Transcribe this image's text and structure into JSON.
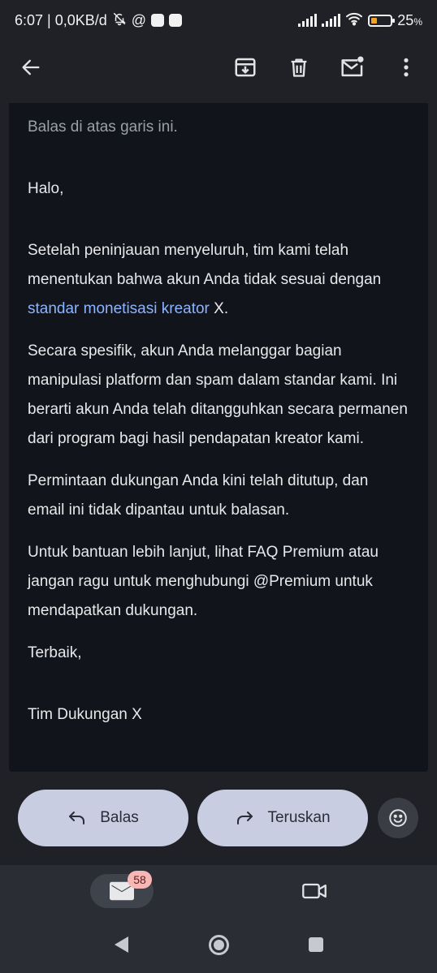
{
  "status_bar": {
    "time_speed": "6:07 | 0,0KB/d",
    "at_symbol": "@",
    "battery_percent": "25",
    "battery_unit": "%"
  },
  "app_bar": {
    "icons": [
      "back-arrow-icon",
      "archive-icon",
      "trash-icon",
      "mark-unread-icon",
      "more-vert-icon"
    ]
  },
  "email": {
    "quote_line": "Balas di atas garis ini.",
    "greeting": "Halo,",
    "p1_before": "Setelah peninjauan menyeluruh, tim kami telah menentukan bahwa akun Anda tidak sesuai dengan ",
    "p1_link": "standar monetisasi kreator",
    "p1_after": " X.",
    "p2": "Secara spesifik, akun Anda melanggar bagian manipulasi platform dan spam dalam standar kami. Ini berarti akun Anda telah ditangguhkan secara permanen dari program bagi hasil pendapatan kreator kami.",
    "p3": "Permintaan dukungan Anda kini telah ditutup, dan email ini tidak dipantau untuk balasan.",
    "p4": "Untuk bantuan lebih lanjut, lihat FAQ Premium atau jangan ragu untuk menghubungi @Premium untuk mendapatkan dukungan.",
    "closing": "Terbaik,",
    "signature": "Tim Dukungan X"
  },
  "actions": {
    "reply_label": "Balas",
    "forward_label": "Teruskan"
  },
  "bottom_nav": {
    "mail_badge": "58"
  },
  "colors": {
    "background": "#1f2126",
    "card": "#11141b",
    "link": "#8cb4ff",
    "pill": "#c8cde2",
    "badge": "#f6b7b5",
    "battery_fill": "#f2a224"
  }
}
